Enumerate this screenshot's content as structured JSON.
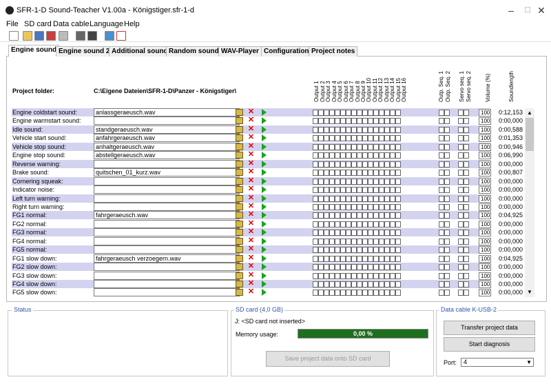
{
  "window": {
    "title": "SFR-1-D Sound-Teacher V1.00a - Königstiger.sfr-1-d",
    "minimize": "–",
    "maximize": "☐",
    "close": "✕"
  },
  "menu": [
    "File",
    "SD card",
    "Data cable",
    "Language",
    "Help"
  ],
  "toolbar_icons": [
    "new-file-icon",
    "open-folder-icon",
    "save-icon",
    "save-as-icon",
    "print-icon",
    "tool-icon",
    "settings-icon",
    "music-icon",
    "help-book-icon"
  ],
  "tabs": [
    "Engine sound",
    "Engine sound 2",
    "Additional sound",
    "Random sound",
    "WAV-Player",
    "Configuration",
    "Project notes"
  ],
  "active_tab": "Engine sound",
  "project": {
    "label": "Project folder:",
    "path": "C:\\Eigene Dateien\\SFR-1-D\\Panzer - Königstiger\\"
  },
  "columns": [
    "Output 1",
    "Output 2",
    "Output 3",
    "Output 4",
    "Output 5",
    "Output 6",
    "Output 7",
    "Output 8",
    "Output 9",
    "Output 10",
    "Output 11",
    "Output 12",
    "Output 13",
    "Output 14",
    "Output 15",
    "Output 16",
    "Outp. Seq. 1",
    "Outp. Seq. 2",
    "Servo seq. 1",
    "Servo seq. 2",
    "Volume (%)",
    "Soundlength"
  ],
  "rows": [
    {
      "label": "Engine coldstart sound:",
      "file": "anlassgeraeusch.wav",
      "volume": "100",
      "length": "0:12,153"
    },
    {
      "label": "Engine warmstart sound:",
      "file": "",
      "volume": "100",
      "length": "0:00,000"
    },
    {
      "label": "Idle sound:",
      "file": "standgeraeusch.wav",
      "volume": "100",
      "length": "0:00,588"
    },
    {
      "label": "Vehicle start sound:",
      "file": "anfahrgeraeusch.wav",
      "volume": "100",
      "length": "0:01,353"
    },
    {
      "label": "Vehicle stop sound:",
      "file": "anhaltgeraeusch.wav",
      "volume": "100",
      "length": "0:00,946"
    },
    {
      "label": "Engine stop sound:",
      "file": "abstellgeraeusch.wav",
      "volume": "100",
      "length": "0:06,990"
    },
    {
      "label": "Reverse warning:",
      "file": "",
      "volume": "100",
      "length": "0:00,000"
    },
    {
      "label": "Brake sound:",
      "file": "quitschen_01_kurz.wav",
      "volume": "100",
      "length": "0:00,807"
    },
    {
      "label": "Cornering squeak:",
      "file": "",
      "volume": "100",
      "length": "0:00,000"
    },
    {
      "label": "Indicator noise:",
      "file": "",
      "volume": "100",
      "length": "0:00,000"
    },
    {
      "label": "Left turn warning:",
      "file": "",
      "volume": "100",
      "length": "0:00,000"
    },
    {
      "label": "Right turn warning:",
      "file": "",
      "volume": "100",
      "length": "0:00,000"
    },
    {
      "label": "FG1 normal:",
      "file": "fahrgeraeusch.wav",
      "volume": "100",
      "length": "0:04,925"
    },
    {
      "label": "FG2 normal:",
      "file": "",
      "volume": "100",
      "length": "0:00,000"
    },
    {
      "label": "FG3 normal:",
      "file": "",
      "volume": "100",
      "length": "0:00,000"
    },
    {
      "label": "FG4 normal:",
      "file": "",
      "volume": "100",
      "length": "0:00,000"
    },
    {
      "label": "FG5 normal:",
      "file": "",
      "volume": "100",
      "length": "0:00,000"
    },
    {
      "label": "FG1 slow down:",
      "file": "fahrgeraeusch verzoegern.wav",
      "volume": "100",
      "length": "0:04,925"
    },
    {
      "label": "FG2 slow down:",
      "file": "",
      "volume": "100",
      "length": "0:00,000"
    },
    {
      "label": "FG3 slow down:",
      "file": "",
      "volume": "100",
      "length": "0:00,000"
    },
    {
      "label": "FG4 slow down:",
      "file": "",
      "volume": "100",
      "length": "0:00,000"
    },
    {
      "label": "FG5 slow down:",
      "file": "",
      "volume": "100",
      "length": "0:00,000"
    }
  ],
  "status": {
    "title": "Status"
  },
  "sd": {
    "title": "SD card (4,0 GB)",
    "drive": "J: <SD card not inserted>",
    "memory_label": "Memory usage:",
    "memory_value": "0,00 %",
    "memory_fraction": 0.0,
    "save_button": "Save project data onto SD card"
  },
  "cable": {
    "title": "Data cable K-USB-2",
    "transfer_button": "Transfer project data",
    "diagnosis_button": "Start diagnosis",
    "port_label": "Port:",
    "port_value": "4"
  },
  "colors": {
    "accent_row": "#d3d3f0",
    "memory_bar": "#1e6f1e",
    "group_title": "#3355aa"
  }
}
